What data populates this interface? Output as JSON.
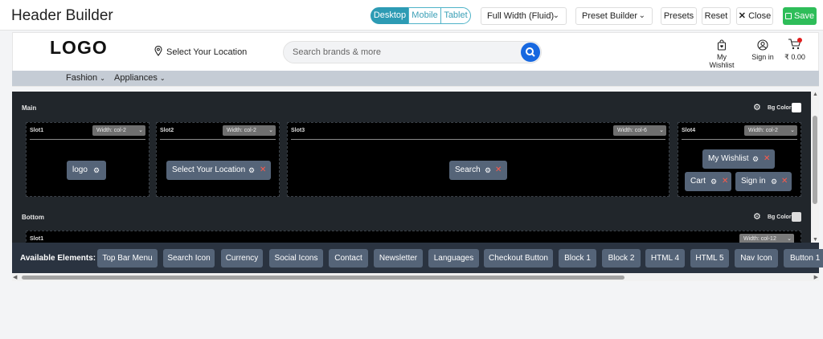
{
  "header": {
    "title": "Header Builder",
    "devices": [
      "Desktop",
      "Mobile",
      "Tablet"
    ],
    "active_device": "Desktop",
    "width_select": "Full Width (Fluid)",
    "preset_select": "Preset Builder",
    "presets_label": "Presets",
    "reset_label": "Reset",
    "close_label": "Close",
    "save_label": "Save",
    "save_color": "#2ebd59",
    "accent_color": "#2d9bb4"
  },
  "preview": {
    "logo": "LOGO",
    "location": "Select Your Location",
    "search_placeholder": "Search brands & more",
    "wishlist": "My Wishlist",
    "signin": "Sign in",
    "cart_amount": "₹ 0.00",
    "categories": [
      "Fashion",
      "Appliances"
    ]
  },
  "builder": {
    "main_label": "Main",
    "bottom_label": "Bottom",
    "bg_color_label": "Bg Color",
    "slots": [
      {
        "name": "Slot1",
        "width": "Width: col-2",
        "items": [
          "logo"
        ]
      },
      {
        "name": "Slot2",
        "width": "Width: col-2",
        "items": [
          "Select Your Location"
        ]
      },
      {
        "name": "Slot3",
        "width": "Width: col-6",
        "items": [
          "Search"
        ]
      },
      {
        "name": "Slot4",
        "width": "Width: col-2",
        "items": [
          "My Wishlist",
          "Cart",
          "Sign in"
        ]
      }
    ],
    "bottom_slot": {
      "name": "Slot1",
      "width": "Width: col-12"
    }
  },
  "available": {
    "label": "Available Elements:",
    "items": [
      "Top Bar Menu",
      "Search Icon",
      "Currency",
      "Social Icons",
      "Contact",
      "Newsletter",
      "Languages",
      "Checkout Button",
      "Block 1",
      "Block 2",
      "HTML 4",
      "HTML 5",
      "Nav Icon",
      "Button 1"
    ]
  }
}
